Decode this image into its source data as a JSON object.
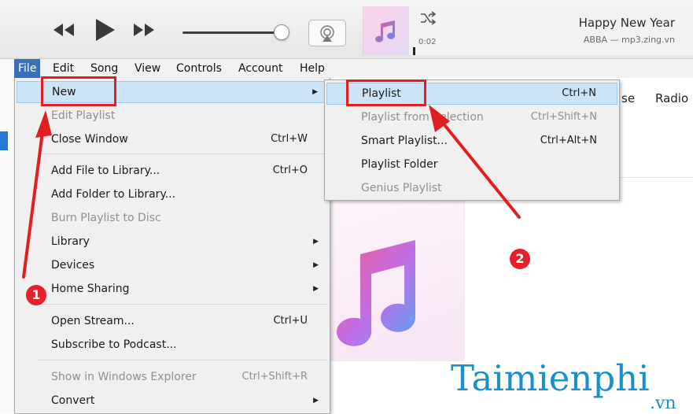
{
  "player": {
    "elapsed": "0:02",
    "song_title": "Happy New Year",
    "song_artist": "ABBA — mp3.zing.vn"
  },
  "menubar": {
    "items": [
      "File",
      "Edit",
      "Song",
      "View",
      "Controls",
      "Account",
      "Help"
    ]
  },
  "file_menu": {
    "items": [
      {
        "label": "New",
        "shortcut": "",
        "submenu": true,
        "disabled": false
      },
      {
        "label": "Edit Playlist",
        "shortcut": "",
        "submenu": false,
        "disabled": true
      },
      {
        "label": "Close Window",
        "shortcut": "Ctrl+W",
        "submenu": false,
        "disabled": false
      },
      {
        "label": "Add File to Library...",
        "shortcut": "Ctrl+O",
        "submenu": false,
        "disabled": false
      },
      {
        "label": "Add Folder to Library...",
        "shortcut": "",
        "submenu": false,
        "disabled": false
      },
      {
        "label": "Burn Playlist to Disc",
        "shortcut": "",
        "submenu": false,
        "disabled": true
      },
      {
        "label": "Library",
        "shortcut": "",
        "submenu": true,
        "disabled": false
      },
      {
        "label": "Devices",
        "shortcut": "",
        "submenu": true,
        "disabled": false
      },
      {
        "label": "Home Sharing",
        "shortcut": "",
        "submenu": true,
        "disabled": false
      },
      {
        "label": "Open Stream...",
        "shortcut": "Ctrl+U",
        "submenu": false,
        "disabled": false
      },
      {
        "label": "Subscribe to Podcast...",
        "shortcut": "",
        "submenu": false,
        "disabled": false
      },
      {
        "label": "Show in Windows Explorer",
        "shortcut": "Ctrl+Shift+R",
        "submenu": false,
        "disabled": true
      },
      {
        "label": "Convert",
        "shortcut": "",
        "submenu": true,
        "disabled": false
      }
    ]
  },
  "new_submenu": {
    "items": [
      {
        "label": "Playlist",
        "shortcut": "Ctrl+N",
        "disabled": false
      },
      {
        "label": "Playlist from Selection",
        "shortcut": "Ctrl+Shift+N",
        "disabled": true
      },
      {
        "label": "Smart Playlist...",
        "shortcut": "Ctrl+Alt+N",
        "disabled": false
      },
      {
        "label": "Playlist Folder",
        "shortcut": "",
        "disabled": false
      },
      {
        "label": "Genius Playlist",
        "shortcut": "",
        "disabled": true
      }
    ]
  },
  "tabs_partial": {
    "browse_fragment": "se",
    "radio": "Radio"
  },
  "annotations": {
    "step1": "1",
    "step2": "2",
    "color": "#e02020"
  },
  "watermark": {
    "main": "Taimienphi",
    "sub": ".vn"
  },
  "colors": {
    "menu_highlight": "#cce4f7",
    "menubar_active": "#3b6fb6",
    "watermark": "#1890c8"
  }
}
